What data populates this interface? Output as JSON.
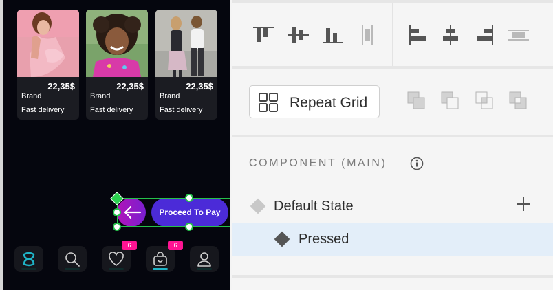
{
  "artboard": {
    "products": [
      {
        "price": "22,35$",
        "brand": "Brand",
        "delivery": "Fast delivery"
      },
      {
        "price": "22,35$",
        "brand": "Brand",
        "delivery": "Fast delivery"
      },
      {
        "price": "22,35$",
        "brand": "Brand",
        "delivery": "Fast delivery"
      }
    ],
    "pay_button": {
      "label": "Proceed To Pay"
    },
    "nav": {
      "items": [
        {
          "icon": "brand-logo-icon",
          "active": false
        },
        {
          "icon": "search-icon",
          "active": false
        },
        {
          "icon": "heart-icon",
          "badge": "6",
          "active": false
        },
        {
          "icon": "shopping-bag-icon",
          "badge": "6",
          "active": true
        },
        {
          "icon": "user-icon",
          "active": false
        }
      ]
    },
    "colors": {
      "background": "#05060e",
      "accent": "#4b2bd8",
      "badge": "#ff1493",
      "active_nav": "#1fb5c8",
      "selection": "#25c04a"
    }
  },
  "panel": {
    "align_icons": [
      "align-top-icon",
      "align-vertical-center-icon",
      "align-bottom-icon",
      "distribute-vertical-icon",
      "align-left-icon",
      "align-horizontal-center-icon",
      "align-right-icon",
      "distribute-horizontal-icon"
    ],
    "repeat_grid": {
      "label": "Repeat Grid"
    },
    "boolean_icons": [
      "add-shapes-icon",
      "subtract-shapes-icon",
      "intersect-shapes-icon",
      "exclude-shapes-icon"
    ],
    "component": {
      "title": "COMPONENT (MAIN)",
      "states": [
        {
          "label": "Default State",
          "selected": false
        },
        {
          "label": "Pressed",
          "selected": true
        }
      ]
    }
  }
}
